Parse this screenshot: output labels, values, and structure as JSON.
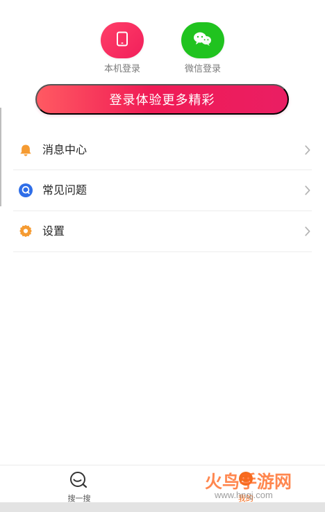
{
  "login_options": [
    {
      "label": "本机登录",
      "icon": "tablet-phone-icon"
    },
    {
      "label": "微信登录",
      "icon": "wechat-icon"
    }
  ],
  "login_cta": {
    "label": "登录体验更多精彩"
  },
  "menu_items": [
    {
      "label": "消息中心",
      "icon": "bell-icon"
    },
    {
      "label": "常见问题",
      "icon": "faq-bubble-icon"
    },
    {
      "label": "设置",
      "icon": "gear-icon"
    }
  ],
  "bottom_nav": [
    {
      "label": "搜一搜",
      "icon": "search-icon"
    },
    {
      "label": "我的",
      "icon": "profile-icon"
    }
  ],
  "watermark": {
    "brand_text": "火鸟手游网",
    "url_text": "www.hnqj.com"
  },
  "colors": {
    "primary_pink": "#f01b55",
    "wechat_green": "#20c31f",
    "orange_accent": "#f36c1d",
    "faq_blue": "#2f6ee8",
    "divider": "#ececec"
  }
}
